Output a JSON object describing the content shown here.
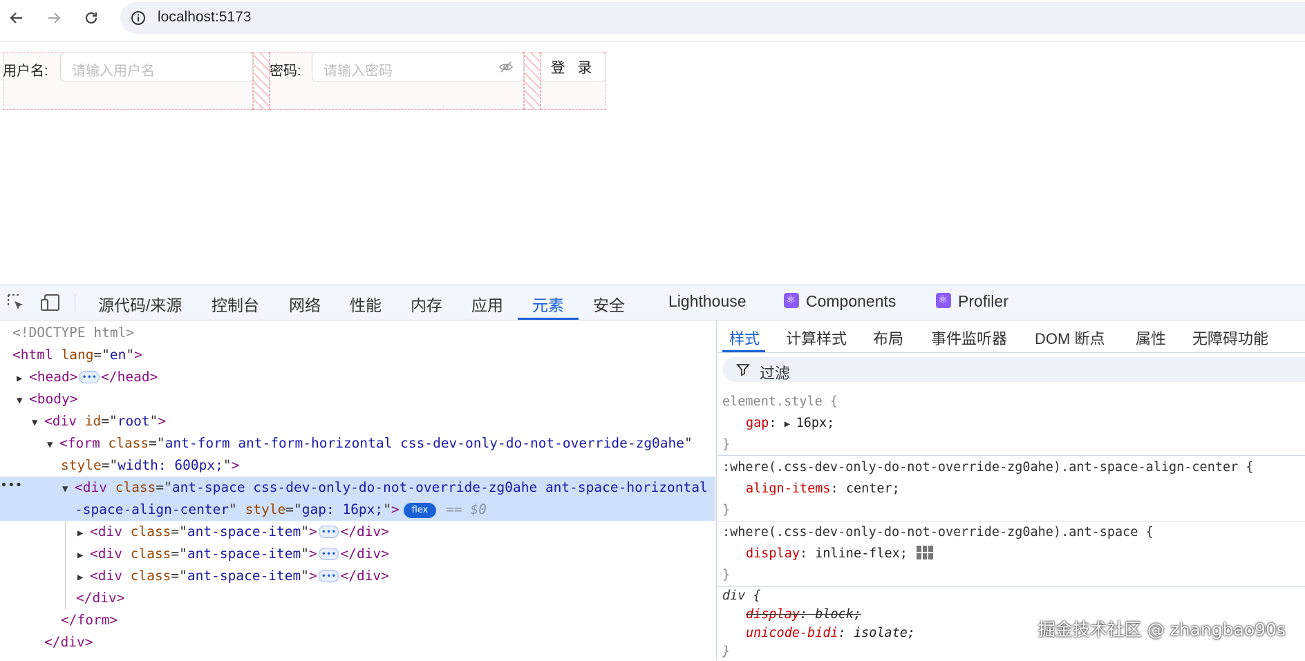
{
  "browser": {
    "url": "localhost:5173"
  },
  "form": {
    "username_label": "用户名:",
    "username_placeholder": "请输入用户名",
    "password_label": "密码:",
    "password_placeholder": "请输入密码",
    "login_button": "登 录"
  },
  "devtools": {
    "tabs": [
      "源代码/来源",
      "控制台",
      "网络",
      "性能",
      "内存",
      "应用",
      "元素",
      "安全",
      "Lighthouse",
      "Components",
      "Profiler"
    ],
    "active_tab": "元素",
    "elements": {
      "doctype": "<!DOCTYPE html>",
      "html_open": "html",
      "html_attr": "lang",
      "html_val": "en",
      "head": "head",
      "body": "body",
      "root_tag": "div",
      "root_attr": "id",
      "root_val": "root",
      "form_tag": "form",
      "form_class_val": "ant-form ant-form-horizontal css-dev-only-do-not-override-zg0ahe",
      "form_style_val": "width: 600px;",
      "space_class_val_1": "ant-space css-dev-only-do-not-override-zg0ahe ant-space-horizontal ant",
      "space_class_val_2": "-space-align-center",
      "space_style_val": "gap: 16px;",
      "flex_badge": "flex",
      "dollar0": "== $0",
      "item_class": "ant-space-item",
      "close_div": "</div>",
      "close_form": "</form>"
    },
    "styles_tabs": [
      "样式",
      "计算样式",
      "布局",
      "事件监听器",
      "DOM 断点",
      "属性",
      "无障碍功能"
    ],
    "styles_active": "样式",
    "filter_placeholder": "过滤",
    "rules": {
      "r1_selector": "element.style {",
      "r1_prop": "gap",
      "r1_val": "16px;",
      "r2_selector": ":where(.css-dev-only-do-not-override-zg0ahe).ant-space-align-center {",
      "r2_prop": "align-items",
      "r2_val": "center;",
      "r3_selector": ":where(.css-dev-only-do-not-override-zg0ahe).ant-space {",
      "r3_prop": "display",
      "r3_val": "inline-flex;",
      "r4_selector": "div {",
      "r4_prop1": "display",
      "r4_val1": "block;",
      "r4_prop2": "unicode-bidi",
      "r4_val2": "isolate;",
      "close": "}"
    }
  },
  "watermark": "掘金技术社区 @ zhangbao90s"
}
